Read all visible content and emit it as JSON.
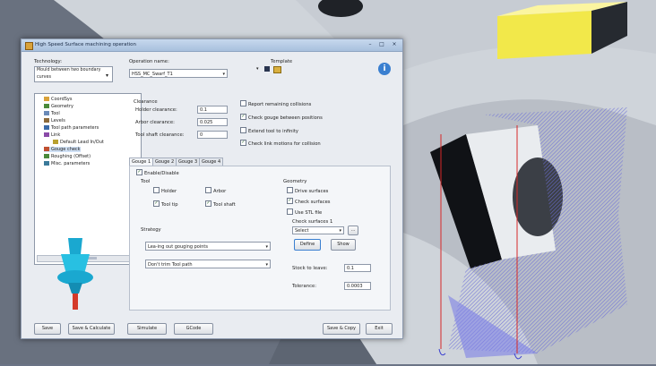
{
  "window": {
    "title": "High Speed Surface machining operation",
    "controls": [
      "–",
      "□",
      "×"
    ]
  },
  "technology": {
    "label": "Technology:",
    "value": "Mould between two boundary curves"
  },
  "operation": {
    "label": "Operation name:",
    "value": "HSS_MC_Swarf_T1"
  },
  "template": {
    "label": "Template"
  },
  "tree": {
    "items": [
      {
        "label": "CoordSys",
        "color": "#d9a23a"
      },
      {
        "label": "Geometry",
        "color": "#4a8a3a"
      },
      {
        "label": "Tool",
        "color": "#6a8ab8"
      },
      {
        "label": "Levels",
        "color": "#8c6a3a"
      },
      {
        "label": "Tool path parameters",
        "color": "#3a6aa8"
      },
      {
        "label": "Link",
        "color": "#8a4aa8"
      },
      {
        "label": "Default Lead In/Out",
        "color": "#b8a030"
      },
      {
        "label": "Gouge check",
        "color": "#c05030"
      },
      {
        "label": "Roughing (Offset)",
        "color": "#4a8a3a"
      },
      {
        "label": "Misc. parameters",
        "color": "#3a7a9a"
      }
    ]
  },
  "clearance": {
    "title": "Clearance",
    "holder_label": "Holder clearance:",
    "holder_value": "0.1",
    "arbor_label": "Arbor clearance:",
    "arbor_value": "0.025",
    "shaft_label": "Tool shaft clearance:",
    "shaft_value": "0"
  },
  "options": [
    {
      "label": "Report remaining collisions",
      "checked": false
    },
    {
      "label": "Check gouge between positions",
      "checked": true
    },
    {
      "label": "Extend tool to infinity",
      "checked": false
    },
    {
      "label": "Check link motions for collision",
      "checked": true
    }
  ],
  "tabs": [
    "Gouge 1",
    "Gouge 2",
    "Gouge 3",
    "Gouge 4"
  ],
  "gouge": {
    "enable_label": "Enable/Disable",
    "tool_title": "Tool",
    "holder": "Holder",
    "arbor": "Arbor",
    "tool_tip": "Tool tip",
    "tool_shaft": "Tool shaft",
    "geometry_title": "Geometry",
    "drive_surfaces": "Drive surfaces",
    "check_surfaces": "Check surfaces",
    "use_stl": "Use STL file",
    "check_surfaces_1": "Check surfaces 1",
    "check_select": "Select",
    "browse": "...",
    "define_btn": "Define",
    "show_btn": "Show",
    "stock_label": "Stock to leave:",
    "stock_value": "0.1",
    "tolerance_label": "Tolerance:",
    "tolerance_value": "0.0003",
    "strategy_title": "Strategy",
    "strategy_value": "Lea-ing out gouging points",
    "toolpath_value": "Don't trim Tool path"
  },
  "footer": {
    "save": "Save",
    "save_calc": "Save & Calculate",
    "simulate": "Simulate",
    "gcode": "GCode",
    "save_copy": "Save & Copy",
    "exit": "Exit"
  }
}
